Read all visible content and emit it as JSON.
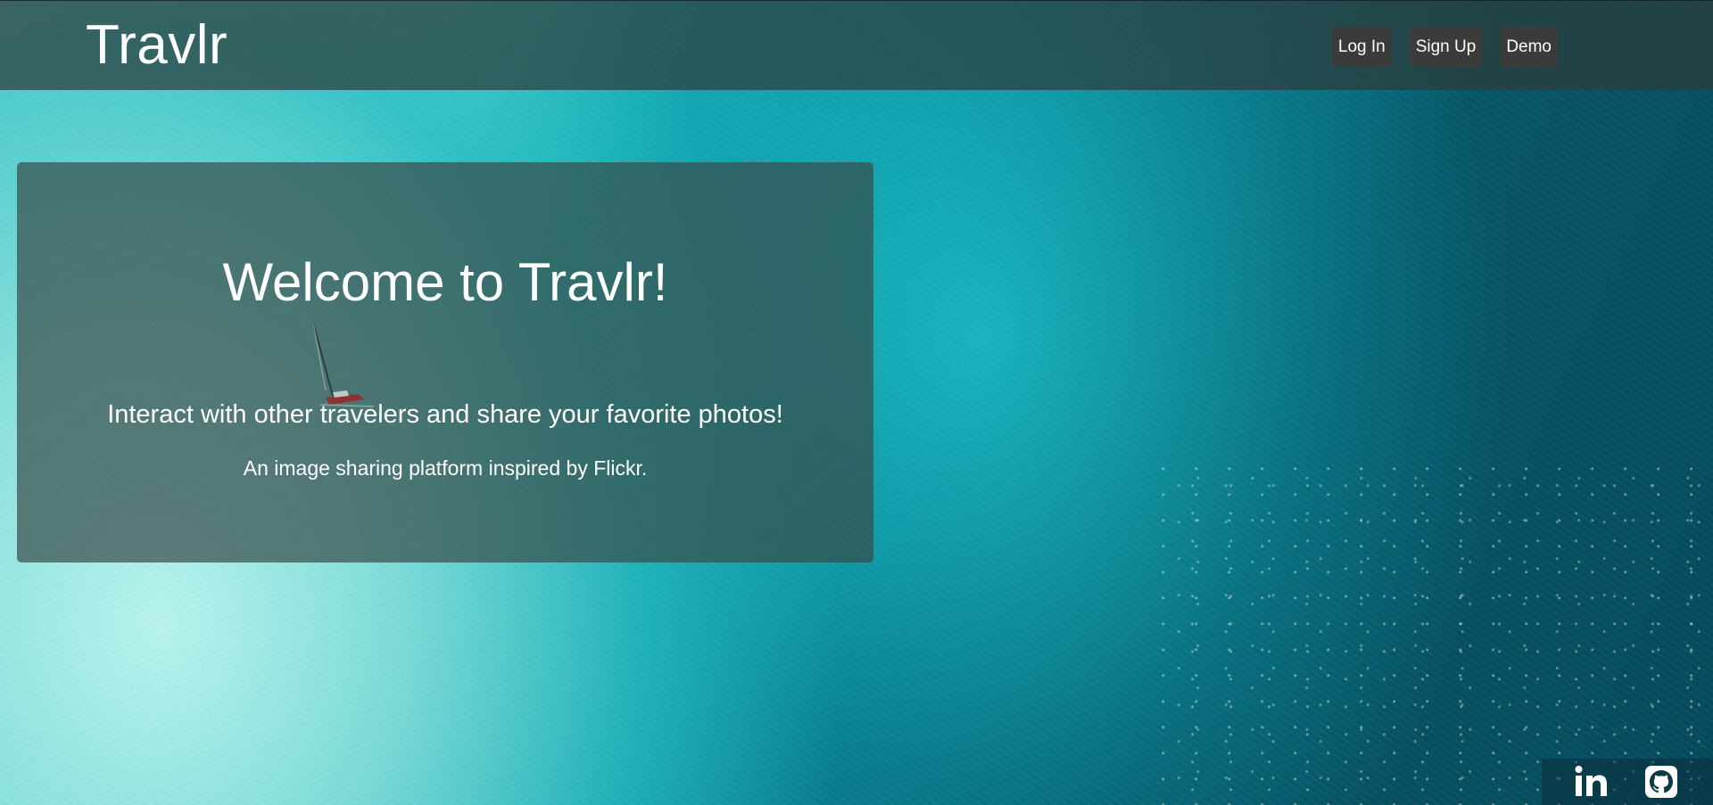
{
  "navbar": {
    "logo": "Travlr",
    "buttons": {
      "login": "Log In",
      "signup": "Sign Up",
      "demo": "Demo"
    }
  },
  "welcome": {
    "title": "Welcome to Travlr!",
    "tagline": "Interact with other travelers and share your favorite photos!",
    "subtitle": "An image sharing platform inspired by Flickr."
  },
  "footer": {
    "links": [
      {
        "icon": "linkedin-icon"
      },
      {
        "icon": "github-icon"
      }
    ]
  },
  "colors": {
    "navbar_bg": "#2d3c3a",
    "button_bg": "#3a3b3b",
    "text": "#ffffff",
    "water_light": "#9fe7e2",
    "water_dark": "#054a5c"
  }
}
